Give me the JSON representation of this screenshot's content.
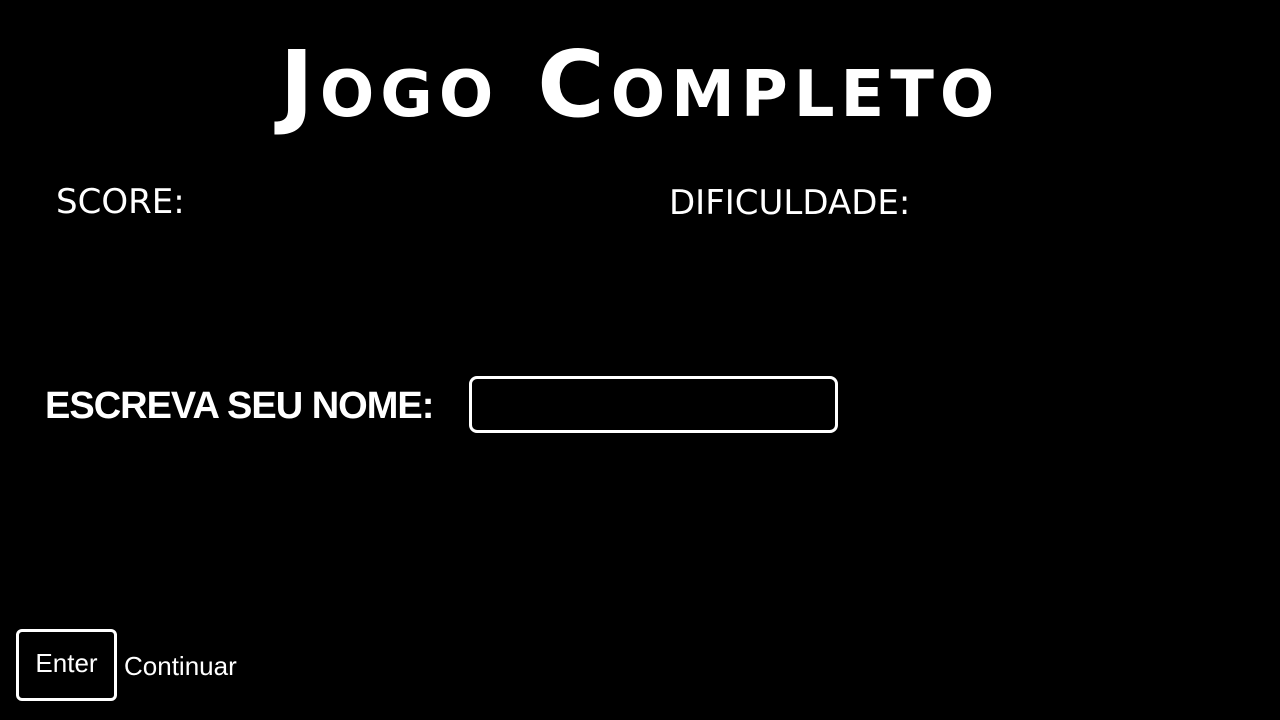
{
  "title": "Jogo Completo",
  "stats": {
    "score_label": "SCORE:",
    "difficulty_label": "DIFICULDADE:"
  },
  "name_entry": {
    "label": "ESCREVA SEU NOME:",
    "value": "",
    "placeholder": ""
  },
  "controls": {
    "enter_key_label": "Enter",
    "continue_label": "Continuar"
  },
  "colors": {
    "background": "#000000",
    "foreground": "#ffffff"
  }
}
